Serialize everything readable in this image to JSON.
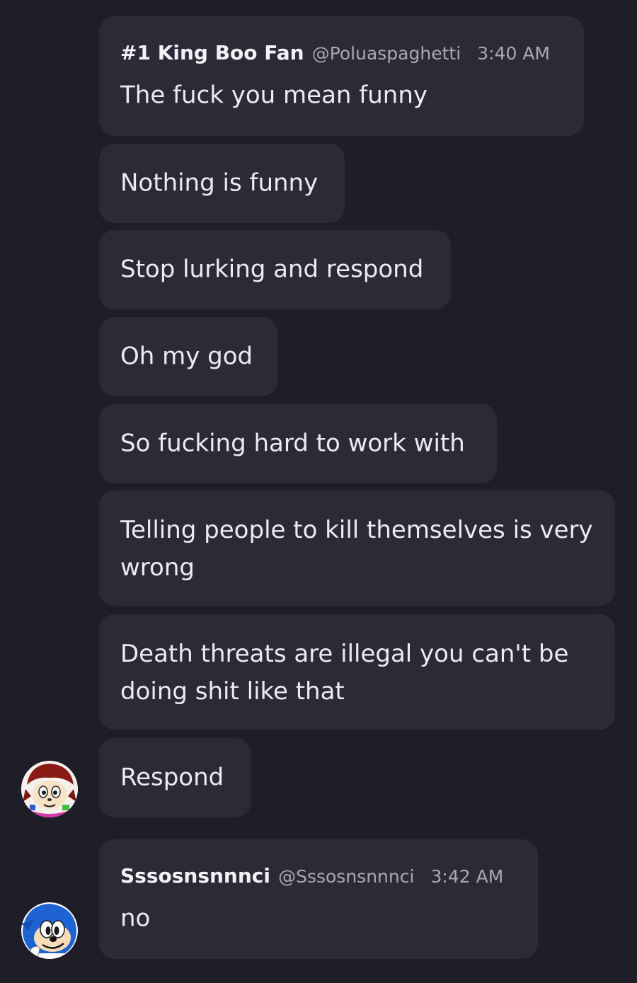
{
  "messages": [
    {
      "author": "#1 King Boo Fan",
      "handle": "@Poluaspaghetti",
      "time": "3:40 AM",
      "text": "The fuck you mean funny"
    },
    {
      "text": "Nothing is funny"
    },
    {
      "text": "Stop lurking and respond"
    },
    {
      "text": "Oh my god"
    },
    {
      "text": "So fucking hard to work with"
    },
    {
      "text": "Telling people to kill themselves is very wrong"
    },
    {
      "text": "Death threats are illegal you can't be doing shit like that"
    },
    {
      "text": "Respond",
      "avatar": "red-hedgehog-avatar"
    },
    {
      "author": "Sssosnsnnnci",
      "handle": "@Sssosnsnnnci",
      "time": "3:42 AM",
      "text": "no",
      "avatar": "sonic-avatar"
    }
  ],
  "colors": {
    "background": "#1f1e28",
    "bubble": "#2b2a37",
    "text": "#ecebf1",
    "muted": "#a9a8b3"
  }
}
